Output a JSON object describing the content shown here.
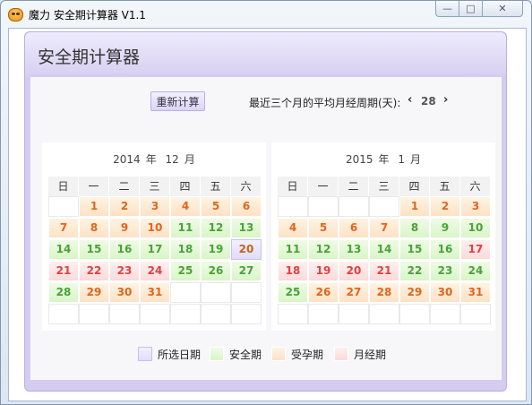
{
  "window": {
    "title": "魔力 安全期计算器 V1.1"
  },
  "panel": {
    "title": "安全期计算器"
  },
  "toolbar": {
    "recalc_label": "重新计算",
    "cycle_label": "最近三个月的平均月经周期(天):",
    "cycle_value": "28",
    "prev": "‹",
    "next": "›"
  },
  "colors": {
    "safe": "#d9f5c8",
    "fertile": "#fde2c6",
    "period": "#fbdada",
    "selected": "#e1dcfa"
  },
  "weekdays": [
    "日",
    "一",
    "二",
    "三",
    "四",
    "五",
    "六"
  ],
  "calendars": [
    {
      "year": "2014",
      "year_suffix": "年",
      "month": "12",
      "month_suffix": "月",
      "rows": [
        [
          [
            "",
            "empty"
          ],
          [
            "1",
            "fertile"
          ],
          [
            "2",
            "fertile"
          ],
          [
            "3",
            "fertile"
          ],
          [
            "4",
            "fertile"
          ],
          [
            "5",
            "fertile"
          ],
          [
            "6",
            "fertile"
          ]
        ],
        [
          [
            "7",
            "fertile"
          ],
          [
            "8",
            "fertile"
          ],
          [
            "9",
            "fertile"
          ],
          [
            "10",
            "fertile"
          ],
          [
            "11",
            "safe"
          ],
          [
            "12",
            "safe"
          ],
          [
            "13",
            "safe"
          ]
        ],
        [
          [
            "14",
            "safe"
          ],
          [
            "15",
            "safe"
          ],
          [
            "16",
            "safe"
          ],
          [
            "17",
            "safe"
          ],
          [
            "18",
            "safe"
          ],
          [
            "19",
            "safe"
          ],
          [
            "20",
            "selected"
          ]
        ],
        [
          [
            "21",
            "period"
          ],
          [
            "22",
            "period"
          ],
          [
            "23",
            "period"
          ],
          [
            "24",
            "period"
          ],
          [
            "25",
            "safe"
          ],
          [
            "26",
            "safe"
          ],
          [
            "27",
            "safe"
          ]
        ],
        [
          [
            "28",
            "safe"
          ],
          [
            "29",
            "fertile"
          ],
          [
            "30",
            "fertile"
          ],
          [
            "31",
            "fertile"
          ],
          [
            "",
            "empty"
          ],
          [
            "",
            "empty"
          ],
          [
            "",
            "empty"
          ]
        ],
        [
          [
            "",
            "empty"
          ],
          [
            "",
            "empty"
          ],
          [
            "",
            "empty"
          ],
          [
            "",
            "empty"
          ],
          [
            "",
            "empty"
          ],
          [
            "",
            "empty"
          ],
          [
            "",
            "empty"
          ]
        ]
      ]
    },
    {
      "year": "2015",
      "year_suffix": "年",
      "month": "1",
      "month_suffix": "月",
      "rows": [
        [
          [
            "",
            "empty"
          ],
          [
            "",
            "empty"
          ],
          [
            "",
            "empty"
          ],
          [
            "",
            "empty"
          ],
          [
            "1",
            "fertile"
          ],
          [
            "2",
            "fertile"
          ],
          [
            "3",
            "fertile"
          ]
        ],
        [
          [
            "4",
            "fertile"
          ],
          [
            "5",
            "fertile"
          ],
          [
            "6",
            "fertile"
          ],
          [
            "7",
            "fertile"
          ],
          [
            "8",
            "safe"
          ],
          [
            "9",
            "safe"
          ],
          [
            "10",
            "safe"
          ]
        ],
        [
          [
            "11",
            "safe"
          ],
          [
            "12",
            "safe"
          ],
          [
            "13",
            "safe"
          ],
          [
            "14",
            "safe"
          ],
          [
            "15",
            "safe"
          ],
          [
            "16",
            "safe"
          ],
          [
            "17",
            "period"
          ]
        ],
        [
          [
            "18",
            "period"
          ],
          [
            "19",
            "period"
          ],
          [
            "20",
            "period"
          ],
          [
            "21",
            "period"
          ],
          [
            "22",
            "safe"
          ],
          [
            "23",
            "safe"
          ],
          [
            "24",
            "safe"
          ]
        ],
        [
          [
            "25",
            "safe"
          ],
          [
            "26",
            "fertile"
          ],
          [
            "27",
            "fertile"
          ],
          [
            "28",
            "fertile"
          ],
          [
            "29",
            "fertile"
          ],
          [
            "30",
            "fertile"
          ],
          [
            "31",
            "fertile"
          ]
        ],
        [
          [
            "",
            "empty"
          ],
          [
            "",
            "empty"
          ],
          [
            "",
            "empty"
          ],
          [
            "",
            "empty"
          ],
          [
            "",
            "empty"
          ],
          [
            "",
            "empty"
          ],
          [
            "",
            "empty"
          ]
        ]
      ]
    }
  ],
  "legend": [
    {
      "label": "所选日期",
      "kind": "selected"
    },
    {
      "label": "安全期",
      "kind": "safe"
    },
    {
      "label": "受孕期",
      "kind": "fertile"
    },
    {
      "label": "月经期",
      "kind": "period"
    }
  ]
}
